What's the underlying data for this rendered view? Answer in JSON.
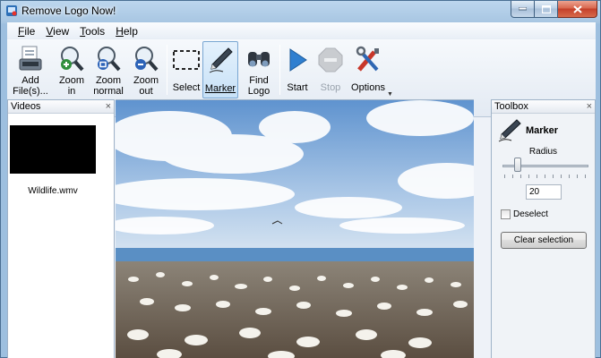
{
  "window": {
    "title": "Remove Logo Now!"
  },
  "menu": [
    {
      "accel": "F",
      "rest": "ile"
    },
    {
      "accel": "V",
      "rest": "iew"
    },
    {
      "accel": "T",
      "rest": "ools"
    },
    {
      "accel": "H",
      "rest": "elp"
    }
  ],
  "toolbar": {
    "add_files": [
      "Add",
      "File(s)..."
    ],
    "zoom_in": [
      "Zoom",
      "in"
    ],
    "zoom_normal": [
      "Zoom",
      "normal"
    ],
    "zoom_out": [
      "Zoom",
      "out"
    ],
    "select": "Select",
    "marker": "Marker",
    "find_logo": [
      "Find",
      "Logo"
    ],
    "start": "Start",
    "stop": "Stop",
    "options": "Options"
  },
  "videos_panel": {
    "title": "Videos",
    "close": "×",
    "items": [
      {
        "name": "Wildlife.wmv"
      }
    ]
  },
  "toolbox": {
    "title": "Toolbox",
    "close": "×",
    "tool_name": "Marker",
    "radius_label": "Radius",
    "radius_value": "20",
    "deselect_label": "Deselect",
    "clear_button": "Clear selection"
  },
  "colors": {
    "accent": "#3a8ad8",
    "window_frame": "#a8c6e2",
    "close_button": "#c4402a"
  },
  "icons": {
    "add_files": "add-files-icon",
    "zoom_in": "zoom-in-icon",
    "zoom_normal": "zoom-normal-icon",
    "zoom_out": "zoom-out-icon",
    "select": "select-rectangle-icon",
    "marker": "marker-pen-icon",
    "find_logo": "binoculars-icon",
    "start": "play-icon",
    "stop": "stop-icon",
    "options": "tools-icon"
  }
}
